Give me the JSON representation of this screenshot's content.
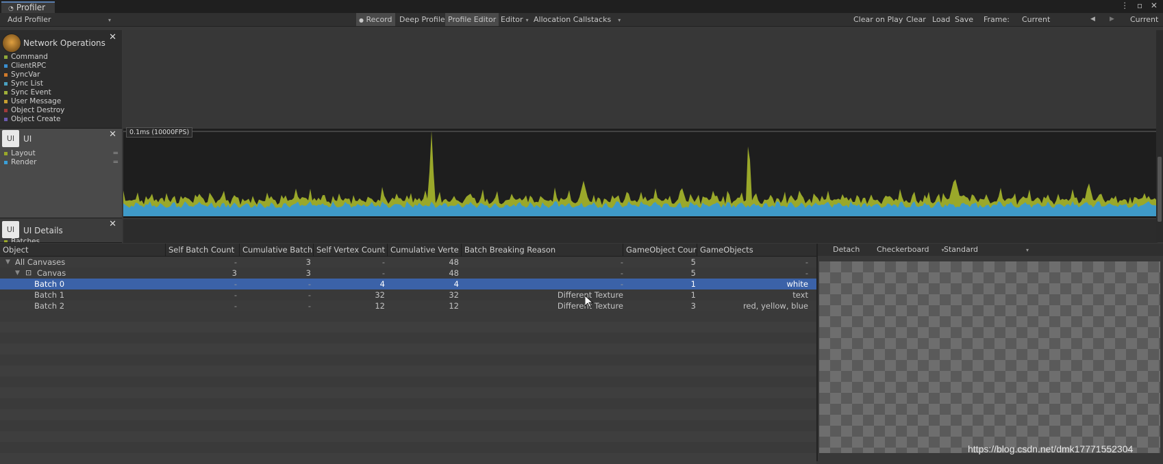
{
  "window": {
    "tab_title": "Profiler",
    "controls": "⋮ ▫ ✕"
  },
  "toolbar": {
    "add_profiler": "Add Profiler",
    "record": "Record",
    "deep_profile": "Deep Profile",
    "profile_editor": "Profile Editor",
    "editor": "Editor",
    "allocation_callstacks": "Allocation Callstacks",
    "clear_on_play": "Clear on Play",
    "clear": "Clear",
    "load": "Load",
    "save": "Save",
    "frame_label": "Frame:",
    "frame_value": "Current",
    "current": "Current"
  },
  "modules": {
    "network": {
      "title": "Network Operations",
      "items": [
        {
          "label": "Command",
          "color": "#8fa83a"
        },
        {
          "label": "ClientRPC",
          "color": "#3a8fd0"
        },
        {
          "label": "SyncVar",
          "color": "#d07a2a"
        },
        {
          "label": "Sync List",
          "color": "#4aa0c0"
        },
        {
          "label": "Sync Event",
          "color": "#9fb03a"
        },
        {
          "label": "User Message",
          "color": "#c8a030"
        },
        {
          "label": "Object Destroy",
          "color": "#a03a3a"
        },
        {
          "label": "Object Create",
          "color": "#6a5ab0"
        }
      ]
    },
    "ui": {
      "badge": "UI",
      "title": "UI",
      "items": [
        {
          "label": "Layout",
          "color": "#9aa82a"
        },
        {
          "label": "Render",
          "color": "#3aa0d8"
        }
      ]
    },
    "ui_details": {
      "badge": "UI",
      "title": "UI Details",
      "partial_item": "Batches"
    }
  },
  "chart": {
    "ms_label": "0.1ms (10000FPS)",
    "layout_color": "#9aa82a",
    "render_color": "#3f9ac8"
  },
  "table": {
    "headers": [
      "Object",
      "Self Batch Count",
      "Cumulative Batch",
      "Self Vertex Count",
      "Cumulative Verte",
      "Batch Breaking Reason",
      "GameObject Cour",
      "GameObjects"
    ],
    "rows": [
      {
        "name": "All Canvases",
        "self_batch": "-",
        "cum_batch": "3",
        "self_vertex": "-",
        "cum_vertex": "48",
        "reason": "-",
        "go_count": "5",
        "gameobjects": "-"
      },
      {
        "name": "Canvas",
        "self_batch": "3",
        "cum_batch": "3",
        "self_vertex": "-",
        "cum_vertex": "48",
        "reason": "-",
        "go_count": "5",
        "gameobjects": "-"
      },
      {
        "name": "Batch 0",
        "self_batch": "-",
        "cum_batch": "-",
        "self_vertex": "4",
        "cum_vertex": "4",
        "reason": "-",
        "go_count": "1",
        "gameobjects": "white"
      },
      {
        "name": "Batch 1",
        "self_batch": "-",
        "cum_batch": "-",
        "self_vertex": "32",
        "cum_vertex": "32",
        "reason": "Different Texture",
        "go_count": "1",
        "gameobjects": "text"
      },
      {
        "name": "Batch 2",
        "self_batch": "-",
        "cum_batch": "-",
        "self_vertex": "12",
        "cum_vertex": "12",
        "reason": "Different Texture",
        "go_count": "3",
        "gameobjects": "red, yellow, blue"
      }
    ]
  },
  "preview": {
    "detach": "Detach",
    "background": "Checkerboard",
    "mode": "Standard"
  },
  "watermark": "https://blog.csdn.net/dmk17771552304"
}
